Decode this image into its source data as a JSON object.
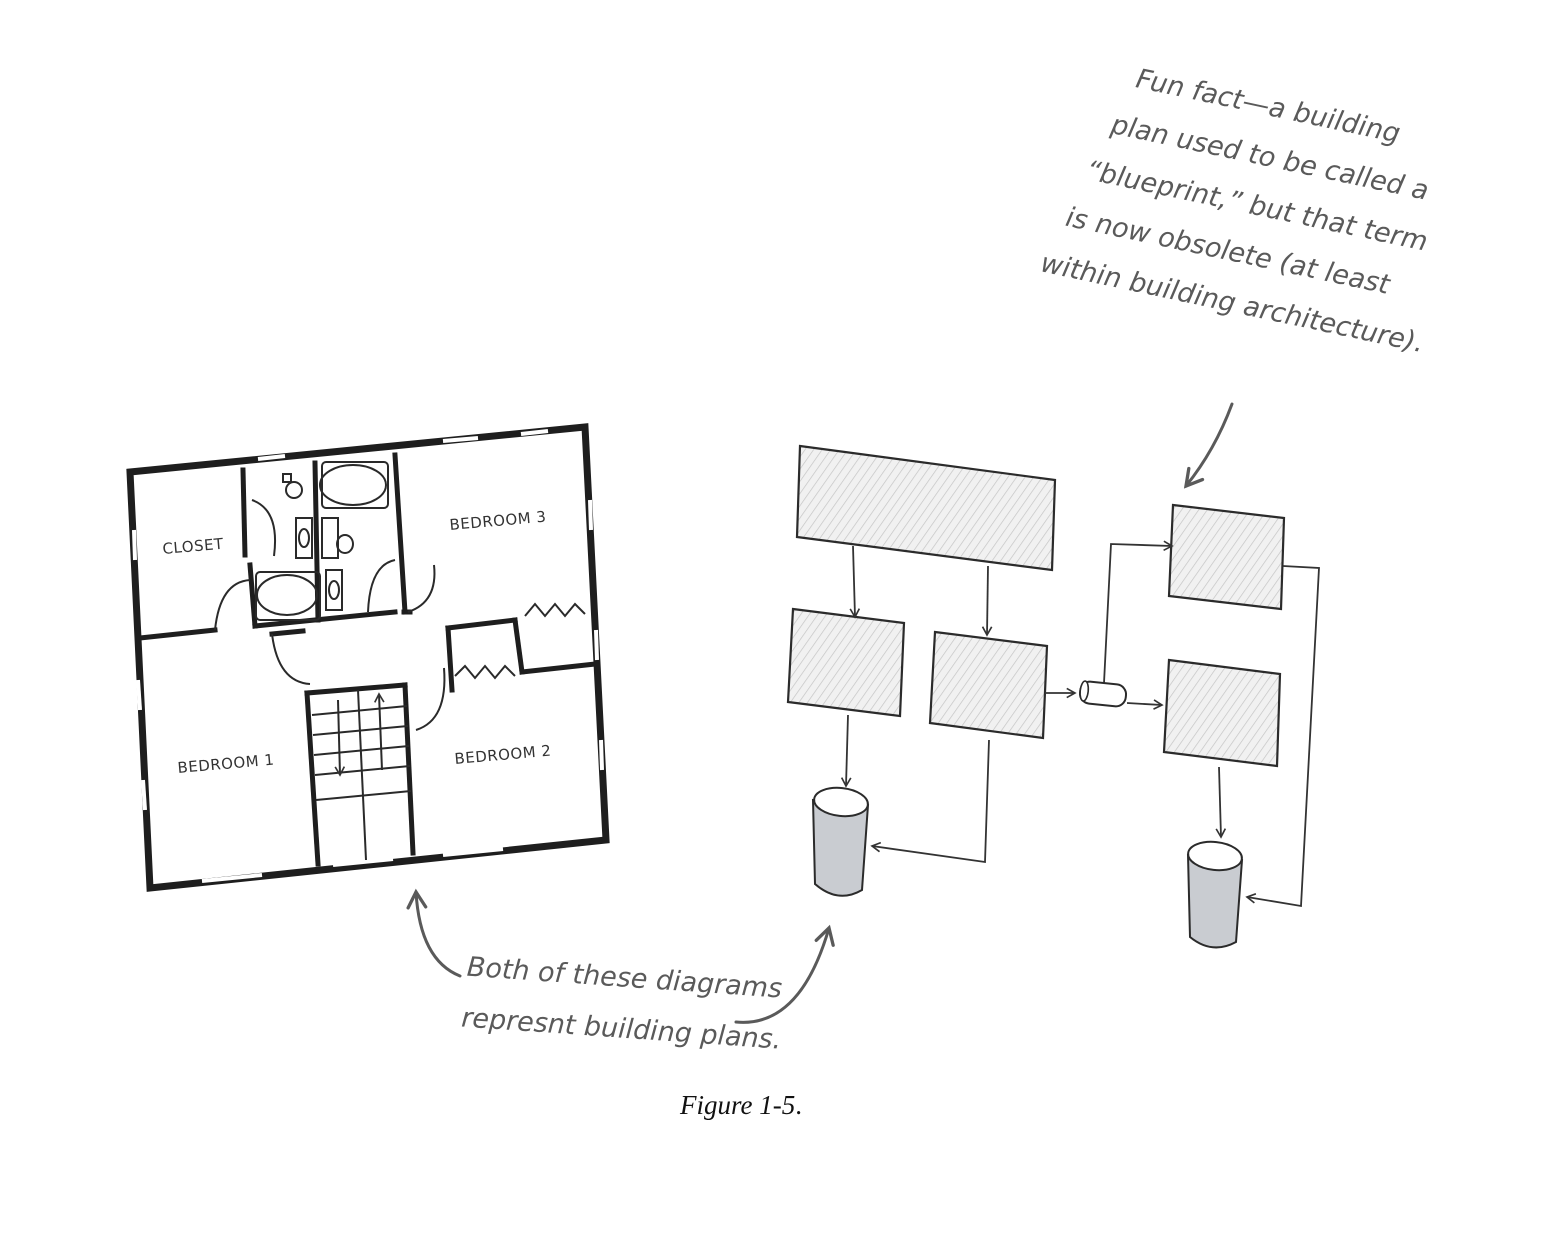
{
  "floor_plan": {
    "rooms": {
      "closet": "CLOSET",
      "bedroom_3": "BEDROOM 3",
      "bedroom_1": "BEDROOM 1",
      "bedroom_2": "BEDROOM 2"
    }
  },
  "notes": {
    "fun_fact_lines": [
      "Fun fact—a building",
      "plan used to be called a",
      "“blueprint,” but that term",
      "is now obsolete (at least",
      "within building architecture)."
    ],
    "both_diagrams_lines": [
      "Both of these diagrams",
      "represnt building plans."
    ]
  },
  "caption": {
    "label": "Figure 1-5",
    "period": "."
  },
  "colors": {
    "ink": "#1e1e1e",
    "pencil_gray": "#5a5a5a",
    "cylinder_fill": "#c9ccd1"
  }
}
